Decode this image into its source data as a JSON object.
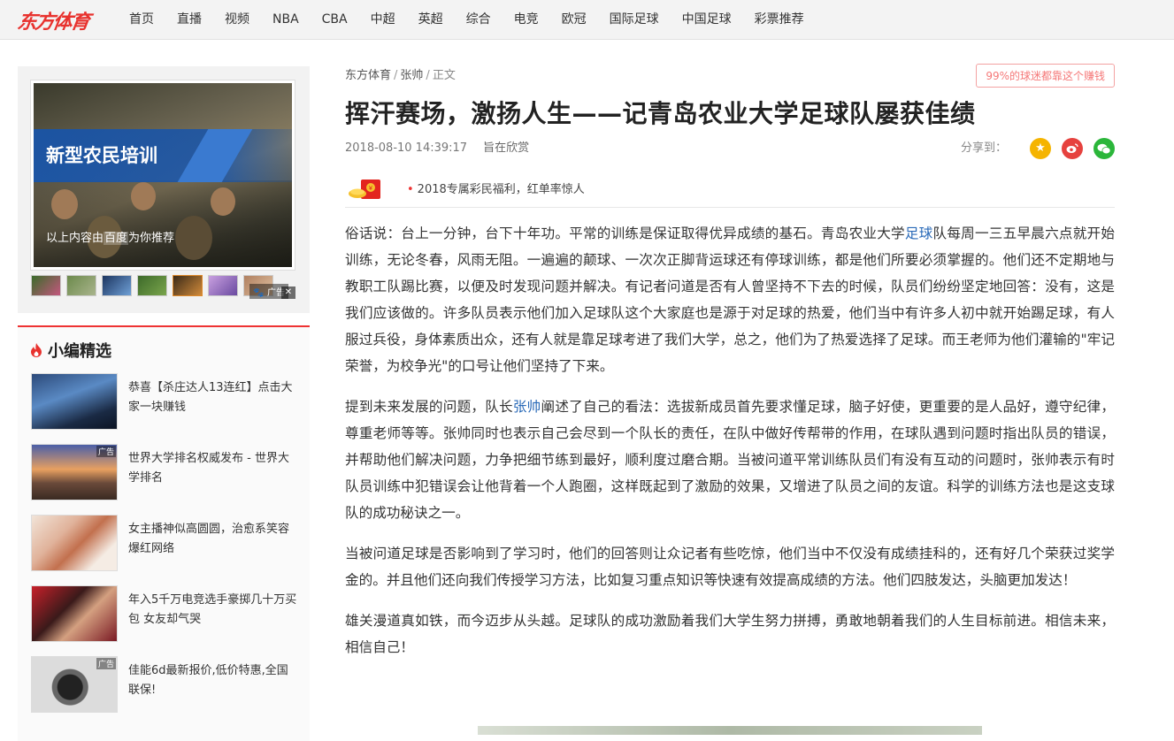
{
  "logo": "东方体育",
  "nav": [
    "首页",
    "直播",
    "视频",
    "NBA",
    "CBA",
    "中超",
    "英超",
    "综合",
    "电竞",
    "欧冠",
    "国际足球",
    "中国足球",
    "彩票推荐"
  ],
  "ad": {
    "banner_text": "新型农民培训",
    "caption_prefix": "以上内容由",
    "caption_highlight": "百度",
    "caption_suffix": "为你推荐",
    "tag": "广告",
    "close": "✕"
  },
  "picks": {
    "title": "小编精选",
    "items": [
      {
        "text": "恭喜【杀庄达人13连红】点击大家一块赚钱",
        "ad": ""
      },
      {
        "text": "世界大学排名权威发布 - 世界大学排名",
        "ad": "广告"
      },
      {
        "text": "女主播神似高圆圆，治愈系笑容爆红网络",
        "ad": ""
      },
      {
        "text": "年入5千万电竞选手豪掷几十万买包 女友却气哭",
        "ad": ""
      },
      {
        "text": "佳能6d最新报价,低价特惠,全国联保!",
        "ad": "广告"
      }
    ]
  },
  "breadcrumb": {
    "home": "东方体育",
    "author": "张帅",
    "current": "正文"
  },
  "promo_button": "99%的球迷都靠这个赚钱",
  "article": {
    "title": "挥汗赛场，激扬人生——记青岛农业大学足球队屡获佳绩",
    "time": "2018-08-10 14:39:17",
    "source": "旨在欣赏",
    "share_label": "分享到："
  },
  "promo_line": "2018专属彩民福利，红单率惊人",
  "paragraphs": {
    "p1a": "俗话说：台上一分钟，台下十年功。平常的训练是保证取得优异成绩的基石。青岛农业大学",
    "p1link": "足球",
    "p1b": "队每周一三五早晨六点就开始训练，无论冬春，风雨无阻。一遍遍的颠球、一次次正脚背运球还有停球训练，都是他们所要必须掌握的。他们还不定期地与教职工队踢比赛，以便及时发现问题并解决。有记者问道是否有人曾坚持不下去的时候，队员们纷纷坚定地回答：没有，这是我们应该做的。许多队员表示他们加入足球队这个大家庭也是源于对足球的热爱，他们当中有许多人初中就开始踢足球，有人服过兵役，身体素质出众，还有人就是靠足球考进了我们大学，总之，他们为了热爱选择了足球。而王老师为他们灌输的\"牢记荣誉，为校争光\"的口号让他们坚持了下来。",
    "p2a": "提到未来发展的问题，队长",
    "p2link": "张帅",
    "p2b": "阐述了自己的看法：选拔新成员首先要求懂足球，脑子好使，更重要的是人品好，遵守纪律，尊重老师等等。张帅同时也表示自己会尽到一个队长的责任，在队中做好传帮带的作用，在球队遇到问题时指出队员的错误，并帮助他们解决问题，力争把细节练到最好，顺利度过磨合期。当被问道平常训练队员们有没有互动的问题时，张帅表示有时队员训练中犯错误会让他背着一个人跑圈，这样既起到了激励的效果，又增进了队员之间的友谊。科学的训练方法也是这支球队的成功秘诀之一。",
    "p3": "当被问道足球是否影响到了学习时，他们的回答则让众记者有些吃惊，他们当中不仅没有成绩挂科的，还有好几个荣获过奖学金的。并且他们还向我们传授学习方法，比如复习重点知识等快速有效提高成绩的方法。他们四肢发达，头脑更加发达！",
    "p4": "雄关漫道真如铁，而今迈步从头越。足球队的成功激励着我们大学生努力拼搏，勇敢地朝着我们的人生目标前进。相信未来，相信自己！"
  },
  "colors": {
    "brand": "#e8322e",
    "link": "#2a6ab8",
    "banner": "#1754aa"
  }
}
